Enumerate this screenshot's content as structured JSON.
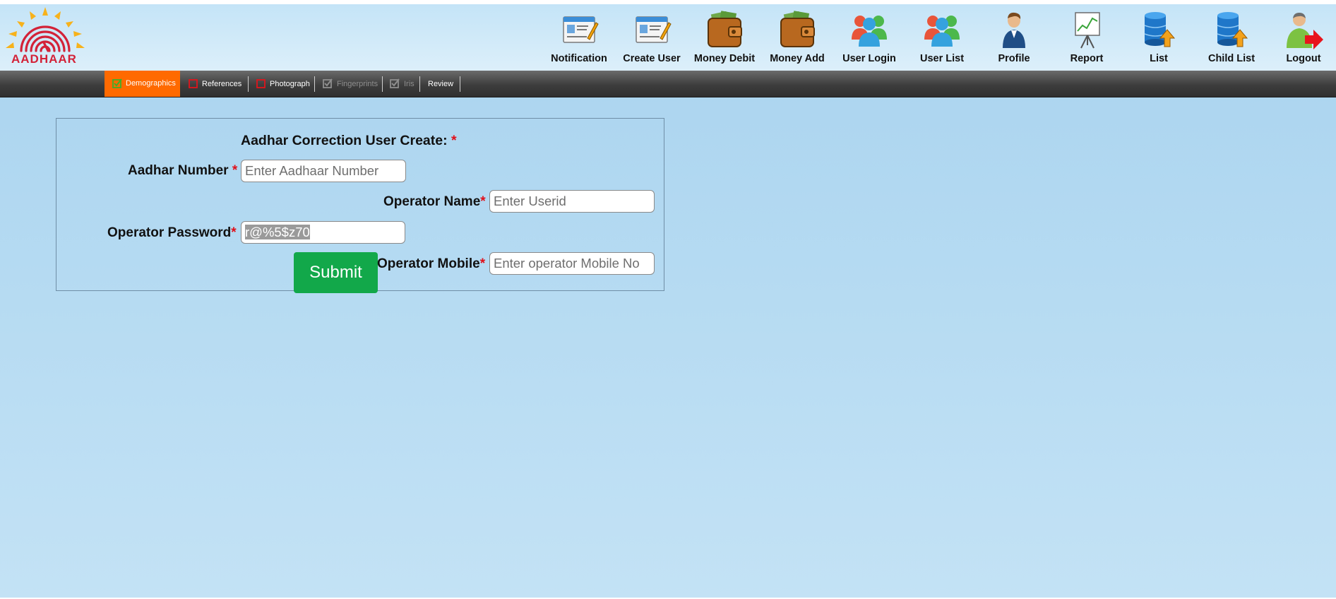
{
  "app": {
    "logo_text": "AADHAAR"
  },
  "nav": {
    "items": [
      {
        "label": "Notification",
        "icon": "notification-icon"
      },
      {
        "label": "Create User",
        "icon": "create-user-icon"
      },
      {
        "label": "Money Debit",
        "icon": "wallet-icon"
      },
      {
        "label": "Money Add",
        "icon": "wallet-icon"
      },
      {
        "label": "User Login",
        "icon": "users-icon"
      },
      {
        "label": "User List",
        "icon": "users-icon"
      },
      {
        "label": "Profile",
        "icon": "profile-icon"
      },
      {
        "label": "Report",
        "icon": "report-chart-icon"
      },
      {
        "label": "List",
        "icon": "database-upload-icon"
      },
      {
        "label": "Child List",
        "icon": "database-upload-icon"
      },
      {
        "label": "Logout",
        "icon": "logout-icon"
      }
    ]
  },
  "tabs": {
    "items": [
      {
        "label": "Demographics",
        "active": true,
        "enabled": true
      },
      {
        "label": "References",
        "active": false,
        "enabled": true
      },
      {
        "label": "Photograph",
        "active": false,
        "enabled": true
      },
      {
        "label": "Fingerprints",
        "active": false,
        "enabled": false
      },
      {
        "label": "Iris",
        "active": false,
        "enabled": false
      },
      {
        "label": "Review",
        "active": false,
        "enabled": true
      }
    ]
  },
  "form": {
    "title": "Aadhar Correction User Create:",
    "required_mark": "*",
    "aadhar_number": {
      "label": "Aadhar Number",
      "placeholder": "Enter Aadhaar Number",
      "value": ""
    },
    "operator_name": {
      "label": "Operator Name",
      "placeholder": "Enter Userid",
      "value": ""
    },
    "operator_password": {
      "label": "Operator Password",
      "value": "r@%5$z70"
    },
    "operator_mobile": {
      "label": "Operator Mobile",
      "placeholder": "Enter operator Mobile No",
      "value": ""
    },
    "submit_label": "Submit"
  },
  "colors": {
    "page_background": "#b6dbf2",
    "active_tab": "#ff6a00",
    "submit_button": "#12a84a",
    "required_mark": "#e0101a",
    "logo_red": "#d32238",
    "logo_sun": "#f7b21b"
  }
}
